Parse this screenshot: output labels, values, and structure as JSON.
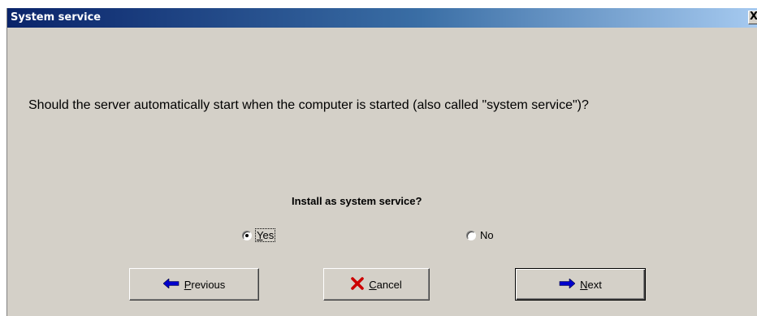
{
  "window": {
    "title": "System service",
    "close_glyph": "X"
  },
  "question": "Should the server automatically start when the computer is started (also called \"system service\")?",
  "install_group": {
    "label": "Install as system service?",
    "options": [
      {
        "accel": "Y",
        "rest": "es",
        "checked": true
      },
      {
        "accel": "",
        "rest": "No",
        "checked": false
      }
    ]
  },
  "buttons": {
    "previous": {
      "accel": "P",
      "rest": "revious",
      "icon": "arrow-left-icon"
    },
    "cancel": {
      "accel": "C",
      "rest": "ancel",
      "icon": "x-icon"
    },
    "next": {
      "accel": "N",
      "rest": "ext",
      "icon": "arrow-right-icon"
    }
  },
  "colors": {
    "dialog_bg": "#d4d0c8",
    "title_start": "#0a246a",
    "title_end": "#a6caf0",
    "arrow_blue": "#0000cc",
    "cancel_red": "#cc0000"
  }
}
